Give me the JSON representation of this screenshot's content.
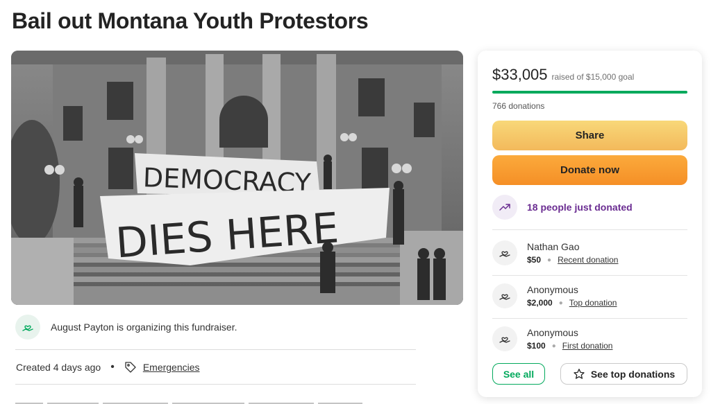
{
  "page": {
    "title": "Bail out Montana Youth Protestors"
  },
  "hero": {
    "banner_line1": "DEMOCRACY",
    "banner_line2": "DIES HERE"
  },
  "organizer": {
    "text": "August Payton is organizing this fundraiser.",
    "icon": "hand-heart-icon"
  },
  "meta": {
    "created": "Created 4 days ago",
    "separator": "•",
    "category": "Emergencies",
    "category_icon": "tag-icon"
  },
  "campaign": {
    "amount_raised": "$33,005",
    "goal_text": "raised of $15,000 goal",
    "progress_fraction": 1.0,
    "donations_count": "766 donations",
    "share_label": "Share",
    "donate_label": "Donate now",
    "recent_activity": "18 people just donated",
    "recent_icon": "trending-up-icon",
    "donors": [
      {
        "name": "Nathan Gao",
        "amount": "$50",
        "kind": "Recent donation"
      },
      {
        "name": "Anonymous",
        "amount": "$2,000",
        "kind": "Top donation"
      },
      {
        "name": "Anonymous",
        "amount": "$100",
        "kind": "First donation"
      }
    ],
    "see_all_label": "See all",
    "see_top_label": "See top donations"
  },
  "colors": {
    "accent_green": "#02a95c",
    "share_yellow": "#f6c769",
    "donate_orange": "#f89a2e",
    "purple": "#6a2c91"
  }
}
